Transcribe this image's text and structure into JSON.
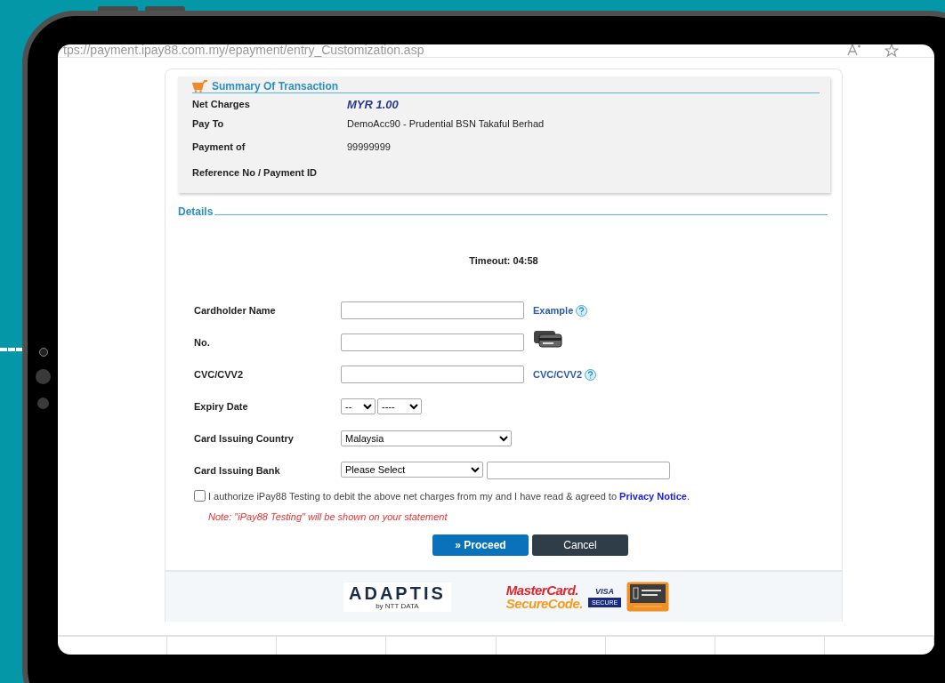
{
  "browser": {
    "url": "tps://payment.ipay88.com.my/epayment/entry_Customization.asp"
  },
  "summary": {
    "title": "Summary Of Transaction",
    "rows": [
      {
        "label": "Net Charges",
        "value": "MYR 1.00",
        "kind": "amount"
      },
      {
        "label": "Pay To",
        "value": "DemoAcc90 - Prudential BSN Takaful Berhad",
        "kind": "text"
      },
      {
        "label": "Payment of",
        "value": "99999999",
        "kind": "text"
      },
      {
        "label": "Reference No / Payment ID",
        "kind": "text"
      }
    ]
  },
  "details": {
    "title": "Details",
    "timeout": "Timeout: 04:58"
  },
  "fields": [
    {
      "label": "Cardholder Name",
      "kind": "text",
      "link": "Example"
    },
    {
      "label": "No.",
      "kind": "card"
    },
    {
      "label": "CVC/CVV2",
      "kind": "text",
      "link": "CVC/CVV2"
    },
    {
      "label": "Expiry Date",
      "kind": "expiry",
      "values": [
        "--",
        "----"
      ]
    },
    {
      "label": "Card Issuing Country",
      "kind": "select",
      "value": "Malaysia"
    },
    {
      "label": "Card Issuing Bank",
      "kind": "select_text",
      "value": "Please Select"
    }
  ],
  "consent": {
    "checked": false,
    "text": "I authorize iPay88 Testing to debit the above net charges from my and I have read & agreed to ",
    "link": "Privacy Notice",
    "end": "."
  },
  "note": "Note: \"iPay88 Testing\" will be shown on your statement",
  "buttons": [
    {
      "label": "» Proceed",
      "kind": "primary"
    },
    {
      "label": "Cancel",
      "kind": "secondary"
    }
  ],
  "footer": {
    "adaptis": "ADAPTIS",
    "adaptis_sub": "by NTT DATA",
    "mastercard_top": "MasterCard.",
    "mastercard_bottom": "SecureCode.",
    "visa": "VISA",
    "visa_sub": "SECURE"
  }
}
